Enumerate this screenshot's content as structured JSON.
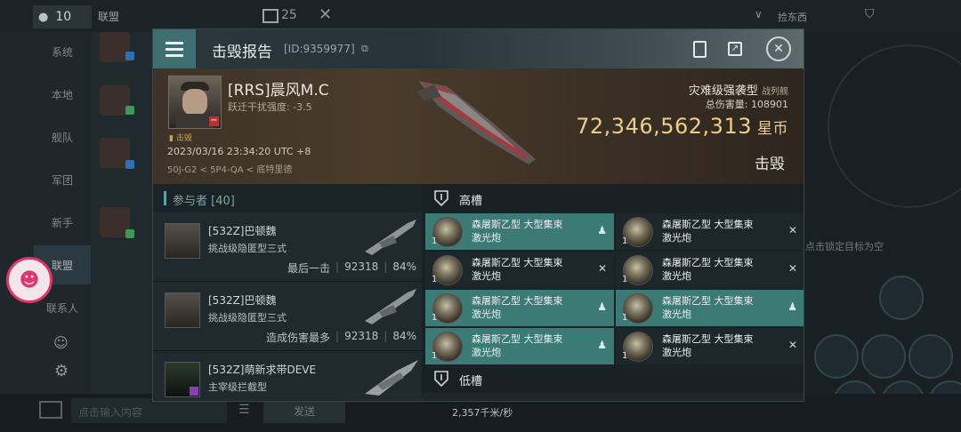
{
  "top": {
    "count": "10",
    "tab": "联盟",
    "tab_count": "25",
    "search_hint": "捡东西"
  },
  "sidebar": {
    "items": [
      "系统",
      "本地",
      "舰队",
      "军团",
      "新手",
      "联盟",
      "联系人"
    ]
  },
  "bottom": {
    "input_placeholder": "点击输入内容",
    "send_label": "发送",
    "speed": "2,357千米/秒"
  },
  "right_panel": {
    "hint": "点击锁定目标为空"
  },
  "dialog": {
    "title": "击毁报告",
    "report_id": "[ID:9359977]",
    "victim": {
      "name": "[RRS]晨风M.C",
      "warp_disrupt": "跃迁干扰强度: -3.5",
      "kill_tag": "击毁",
      "timestamp": "2023/03/16 23:34:20 UTC +8",
      "location": "50J-G2 < 5P4-QA < 底特里德",
      "ship_type": "灾难级强袭型",
      "ship_class": "战列舰",
      "total_damage_label": "总伤害量:",
      "total_damage": "108901",
      "isk_value": "72,346,562,313",
      "isk_unit": "星币",
      "kill_label": "击毁"
    },
    "participants": {
      "header": "参与者 [40]",
      "rows": [
        {
          "name": "[532Z]巴顿魏",
          "ship": "挑战级隐匿型三式",
          "role": "最后一击",
          "damage": "92318",
          "percent": "84%"
        },
        {
          "name": "[532Z]巴顿魏",
          "ship": "挑战级隐匿型三式",
          "role": "造成伤害最多",
          "damage": "92318",
          "percent": "84%"
        },
        {
          "name": "[532Z]萌新求带DEVE",
          "ship": "主宰级拦截型"
        }
      ]
    },
    "high_slots": {
      "label": "高槽",
      "modules": [
        {
          "line1": "森屠斯乙型 大型集束",
          "line2": "激光炮",
          "qty": "1",
          "status": "dropped"
        },
        {
          "line1": "森屠斯乙型 大型集束",
          "line2": "激光炮",
          "qty": "1",
          "status": "destroyed"
        },
        {
          "line1": "森屠斯乙型 大型集束",
          "line2": "激光炮",
          "qty": "1",
          "status": "destroyed"
        },
        {
          "line1": "森屠斯乙型 大型集束",
          "line2": "激光炮",
          "qty": "1",
          "status": "destroyed"
        },
        {
          "line1": "森屠斯乙型 大型集束",
          "line2": "激光炮",
          "qty": "1",
          "status": "dropped"
        },
        {
          "line1": "森屠斯乙型 大型集束",
          "line2": "激光炮",
          "qty": "1",
          "status": "dropped"
        },
        {
          "line1": "森屠斯乙型 大型集束",
          "line2": "激光炮",
          "qty": "1",
          "status": "dropped"
        },
        {
          "line1": "森屠斯乙型 大型集束",
          "line2": "激光炮",
          "qty": "1",
          "status": "destroyed"
        }
      ]
    },
    "low_slots": {
      "label": "低槽"
    }
  },
  "colors": {
    "accent_teal": "#3c7a76",
    "isk_gold": "#e9cf8d",
    "panel_dark": "#141b1e"
  }
}
